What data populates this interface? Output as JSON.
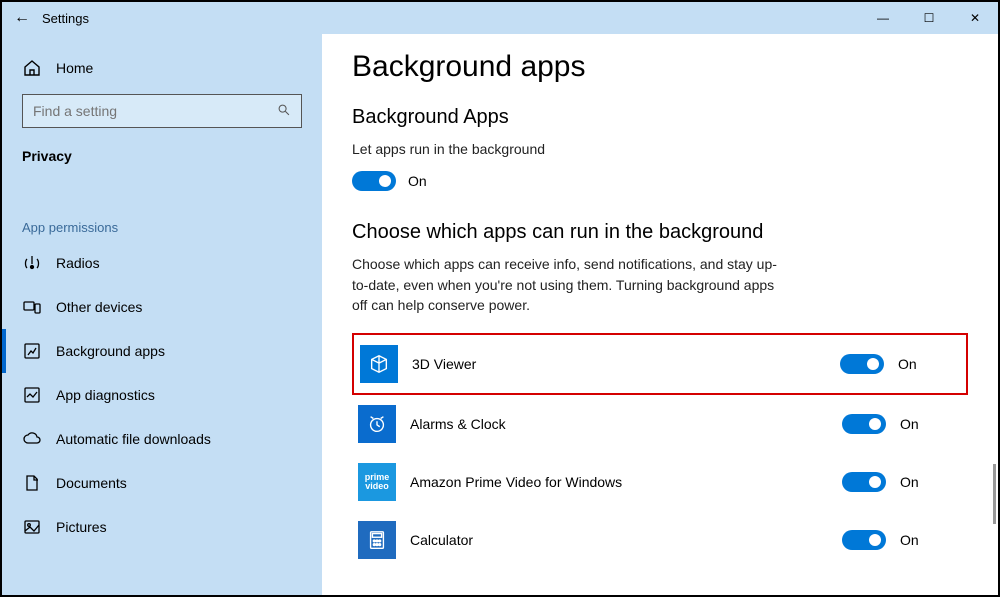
{
  "titlebar": {
    "back_icon": "←",
    "title": "Settings"
  },
  "win_controls": {
    "min": "—",
    "max": "☐",
    "close": "✕"
  },
  "sidebar": {
    "home_label": "Home",
    "search_placeholder": "Find a setting",
    "section_label": "Privacy",
    "group_label": "App permissions",
    "items": [
      {
        "label": "Radios"
      },
      {
        "label": "Other devices"
      },
      {
        "label": "Background apps"
      },
      {
        "label": "App diagnostics"
      },
      {
        "label": "Automatic file downloads"
      },
      {
        "label": "Documents"
      },
      {
        "label": "Pictures"
      }
    ]
  },
  "main": {
    "page_title": "Background apps",
    "section1_title": "Background Apps",
    "section1_desc": "Let apps run in the background",
    "master_toggle_state": "On",
    "section2_title": "Choose which apps can run in the background",
    "section2_desc": "Choose which apps can receive info, send notifications, and stay up-to-date, even when you're not using them. Turning background apps off can help conserve power.",
    "apps": [
      {
        "name": "3D Viewer",
        "state": "On"
      },
      {
        "name": "Alarms & Clock",
        "state": "On"
      },
      {
        "name": "Amazon Prime Video for Windows",
        "state": "On"
      },
      {
        "name": "Calculator",
        "state": "On"
      }
    ]
  }
}
